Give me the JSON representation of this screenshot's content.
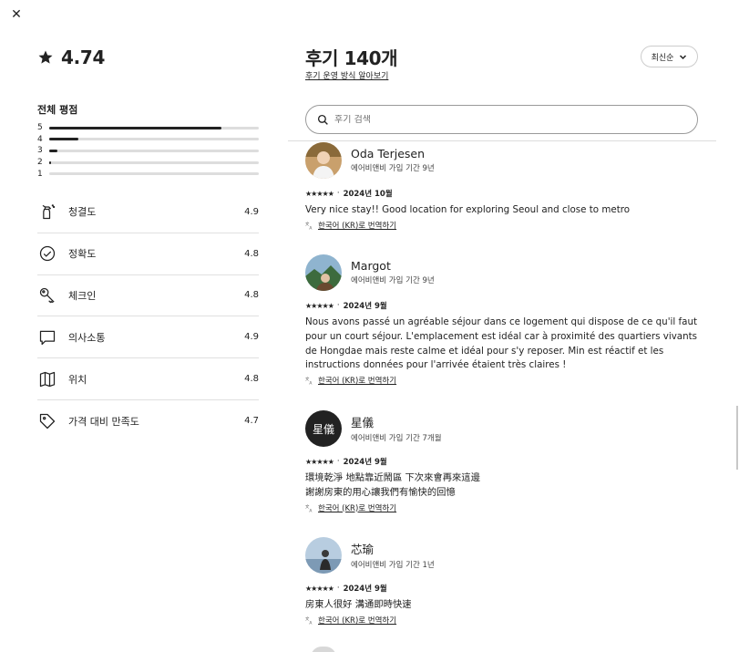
{
  "overall": {
    "score": "4.74"
  },
  "distribution": {
    "title": "전체 평점",
    "rows": [
      {
        "label": "5",
        "fraction": 0.82
      },
      {
        "label": "4",
        "fraction": 0.14
      },
      {
        "label": "3",
        "fraction": 0.04
      },
      {
        "label": "2",
        "fraction": 0.01
      },
      {
        "label": "1",
        "fraction": 0.0
      }
    ]
  },
  "categories": [
    {
      "name": "청결도",
      "score": "4.9",
      "icon": "spray-bottle-icon"
    },
    {
      "name": "정확도",
      "score": "4.8",
      "icon": "check-circle-icon"
    },
    {
      "name": "체크인",
      "score": "4.8",
      "icon": "key-icon"
    },
    {
      "name": "의사소통",
      "score": "4.9",
      "icon": "chat-bubble-icon"
    },
    {
      "name": "위치",
      "score": "4.8",
      "icon": "map-icon"
    },
    {
      "name": "가격 대비 만족도",
      "score": "4.7",
      "icon": "tag-icon"
    }
  ],
  "header": {
    "title": "후기 140개",
    "link": "후기 운영 방식 알아보기",
    "sort_label": "최신순"
  },
  "search": {
    "placeholder": "후기 검색"
  },
  "reviews": [
    {
      "name": "Oda Terjesen",
      "member": "에어비앤비 가입 기간 9년",
      "stars": "★★★★★",
      "date": "2024년 10월",
      "text": "Very nice stay!! Good location for exploring Seoul and close to metro",
      "translate": "한국어 (KR)로 번역하기"
    },
    {
      "name": "Margot",
      "member": "에어비앤비 가입 기간 9년",
      "stars": "★★★★★",
      "date": "2024년 9월",
      "text": "Nous avons passé un agréable séjour dans ce logement qui dispose de ce qu'il faut pour un court séjour. L'emplacement est idéal car à proximité des quartiers vivants de Hongdae mais reste calme et idéal pour s'y reposer. Min est réactif et les instructions données pour l'arrivée étaient très claires !",
      "translate": "한국어 (KR)로 번역하기"
    },
    {
      "name": "星儀",
      "avatar_text": "星儀",
      "member": "에어비앤비 가입 기간 7개월",
      "stars": "★★★★★",
      "date": "2024년 9월",
      "text": "環境乾淨 地點靠近鬧區 下次來會再來這邊\n謝謝房東的用心讓我們有愉快的回憶",
      "translate": "한국어 (KR)로 번역하기"
    },
    {
      "name": "芯瑜",
      "member": "에어비앤비 가입 기간 1년",
      "stars": "★★★★★",
      "date": "2024년 9월",
      "text": "房東人很好 溝通即時快速",
      "translate": "한국어 (KR)로 번역하기"
    }
  ],
  "colors": {
    "text": "#222222",
    "track": "#dddddd",
    "border": "#e0e0e0"
  }
}
